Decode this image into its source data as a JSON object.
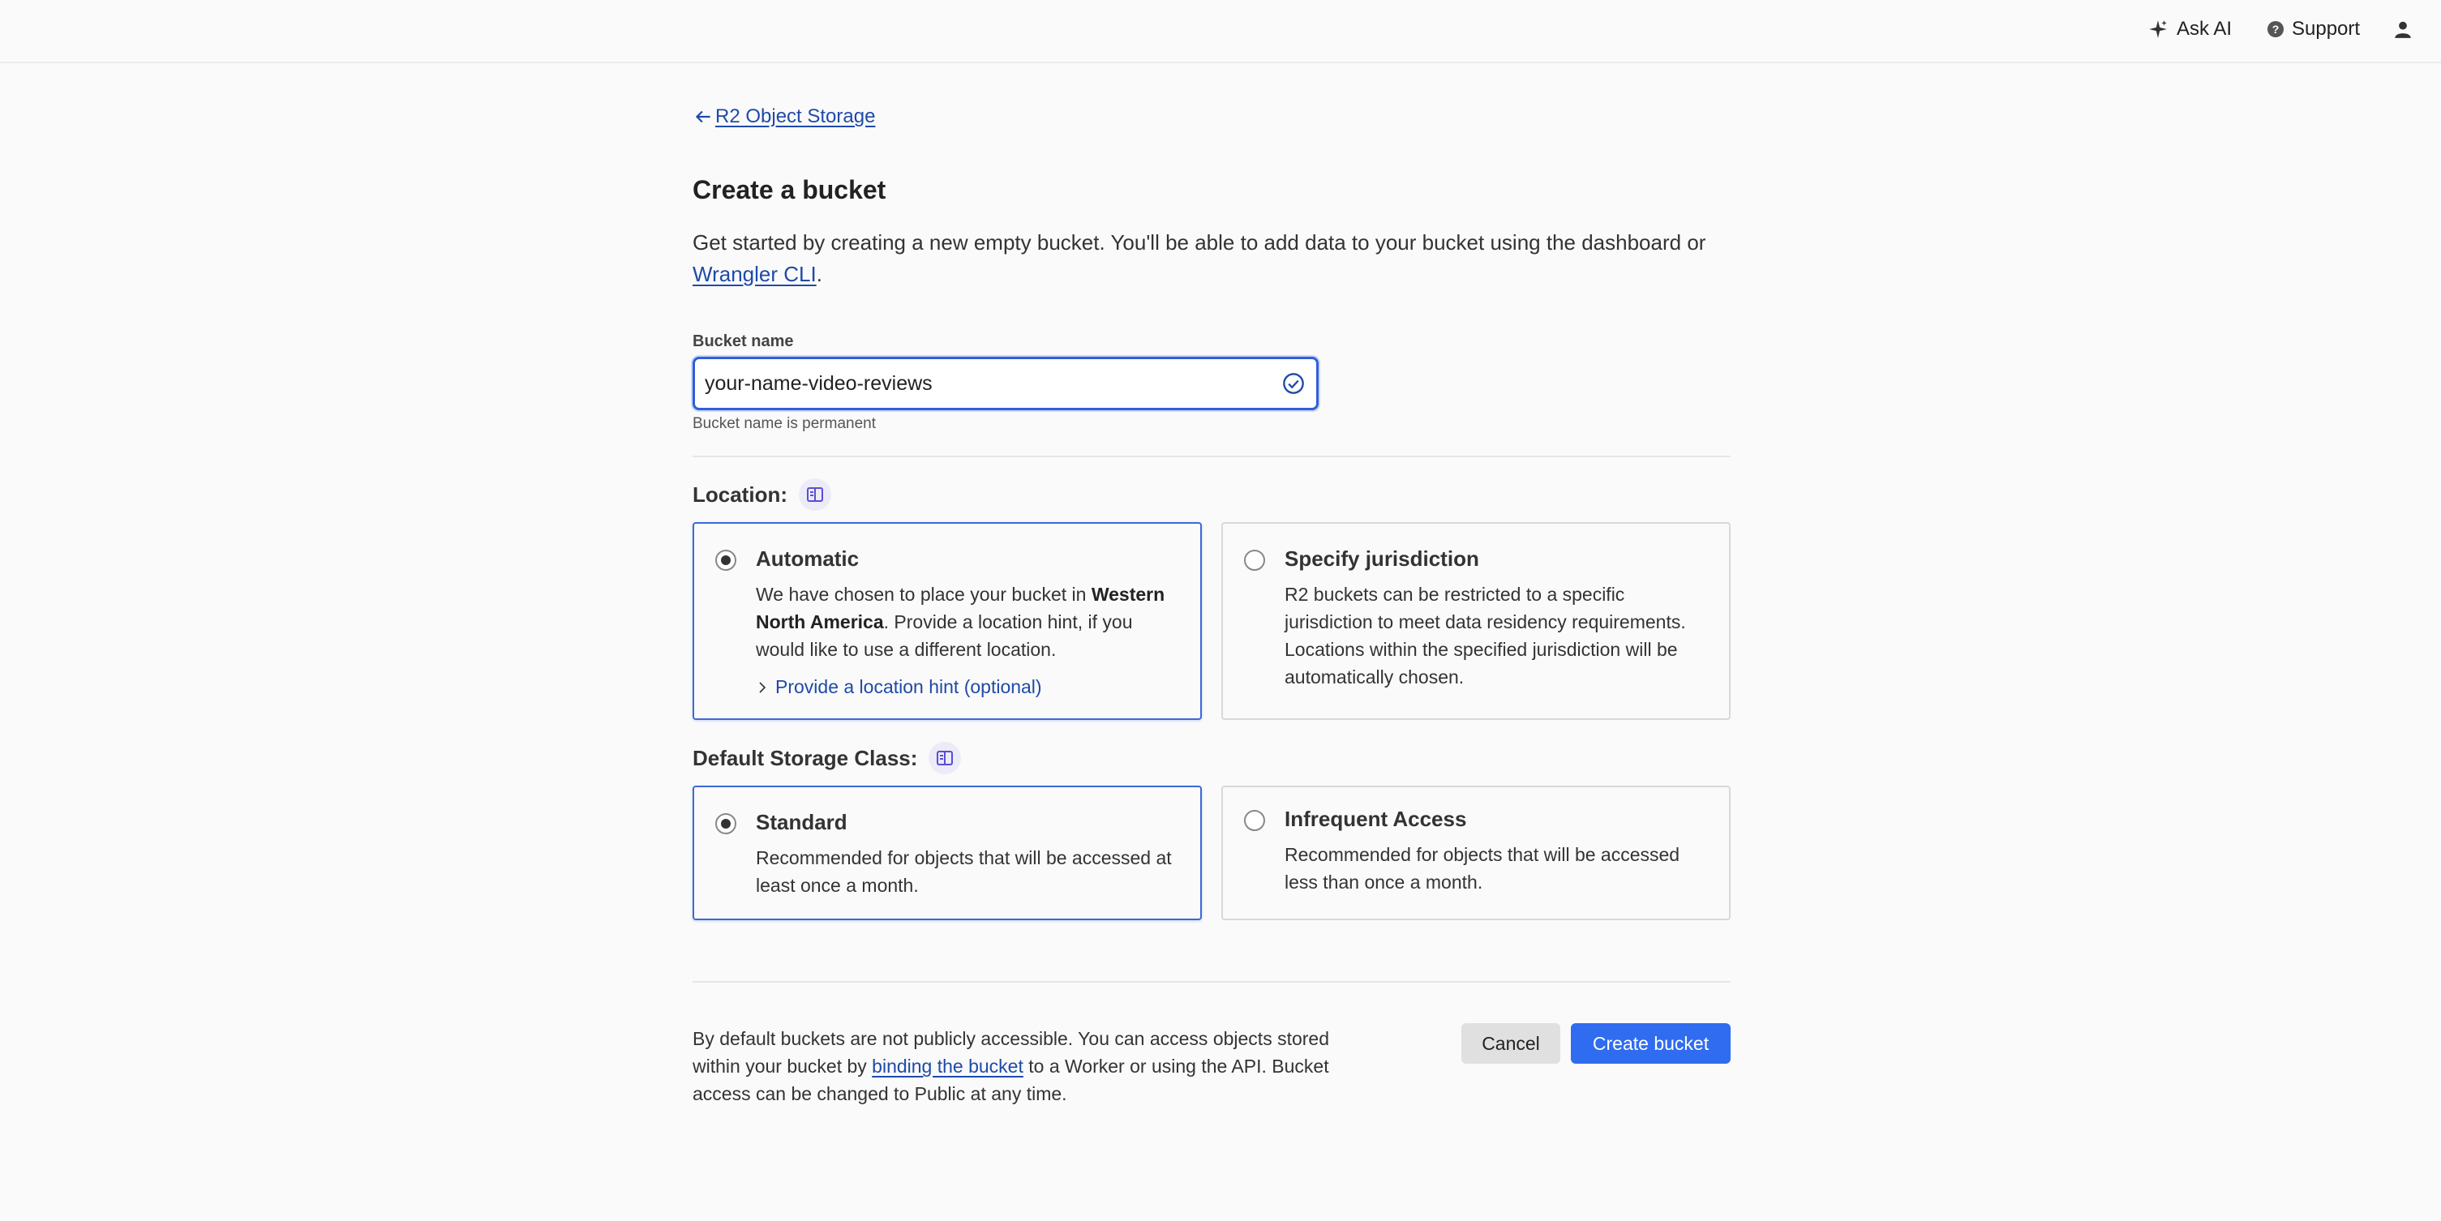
{
  "topbar": {
    "ask_ai": "Ask AI",
    "support": "Support",
    "icons": [
      "sparkle-icon",
      "help-circle-icon",
      "user-icon"
    ]
  },
  "back_link": {
    "label": "R2 Object Storage"
  },
  "page": {
    "title": "Create a bucket",
    "intro_text": "Get started by creating a new empty bucket. You'll be able to add data to your bucket using the dashboard or ",
    "intro_link": "Wrangler CLI",
    "intro_end": "."
  },
  "bucket_name": {
    "label": "Bucket name",
    "value": "your-name-video-reviews",
    "help": "Bucket name is permanent"
  },
  "location": {
    "label": "Location:",
    "options": [
      {
        "title": "Automatic",
        "selected": true,
        "desc_pre": "We have chosen to place your bucket in ",
        "desc_bold": "Western North America",
        "desc_post": ". Provide a location hint, if you would like to use a different location.",
        "link": "Provide a location hint (optional)"
      },
      {
        "title": "Specify jurisdiction",
        "selected": false,
        "desc": "R2 buckets can be restricted to a specific jurisdiction to meet data residency requirements. Locations within the specified jurisdiction will be automatically chosen."
      }
    ]
  },
  "storage_class": {
    "label": "Default Storage Class:",
    "options": [
      {
        "title": "Standard",
        "selected": true,
        "desc": "Recommended for objects that will be accessed at least once a month."
      },
      {
        "title": "Infrequent Access",
        "selected": false,
        "desc": "Recommended for objects that will be accessed less than once a month."
      }
    ]
  },
  "footer": {
    "text_pre": "By default buckets are not publicly accessible. You can access objects stored within your bucket by ",
    "link": "binding the bucket",
    "text_post": " to a Worker or using the API. Bucket access can be changed to Public at any time."
  },
  "actions": {
    "cancel": "Cancel",
    "create": "Create bucket"
  },
  "colors": {
    "accent": "#2f6cf0",
    "link": "#1f4aa8",
    "selected_border": "#3b6ad8"
  }
}
